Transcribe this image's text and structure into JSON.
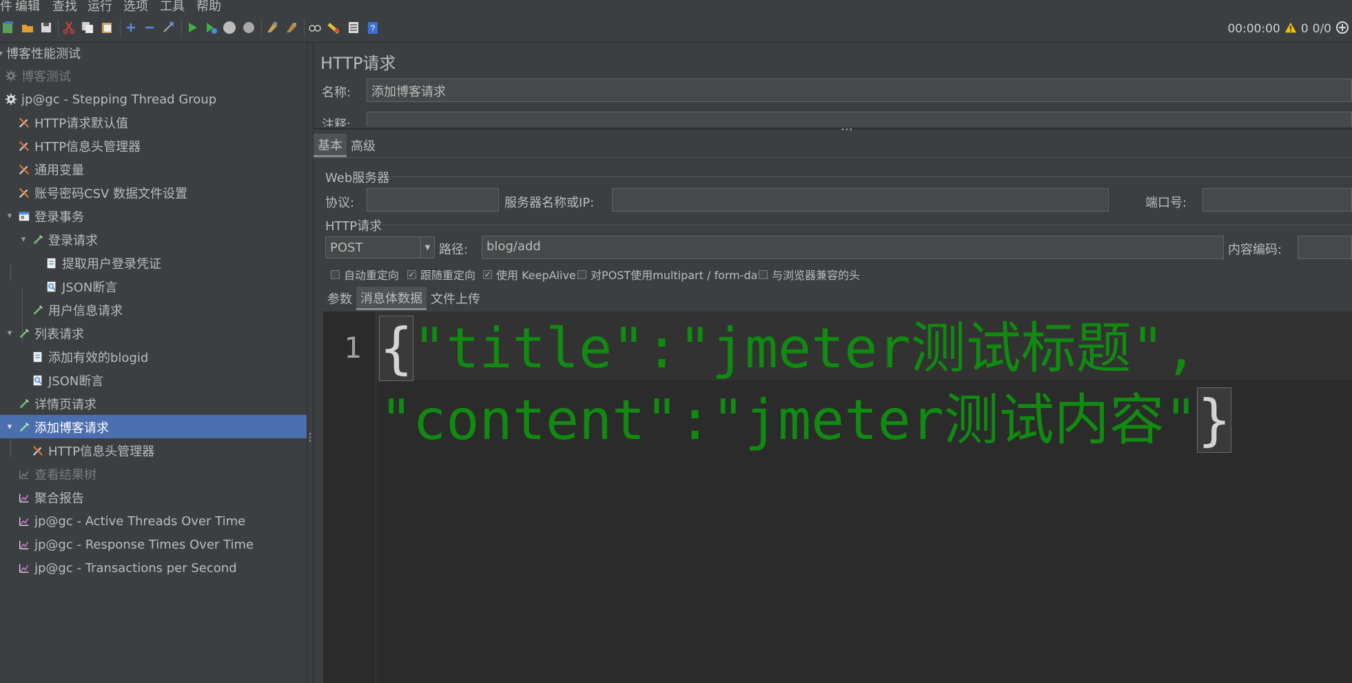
{
  "menu": [
    "件",
    "编辑",
    "查找",
    "运行",
    "选项",
    "工具",
    "帮助"
  ],
  "status": {
    "timer": "00:00:00",
    "warnings": "0",
    "threads": "0/0"
  },
  "tree": {
    "items": [
      {
        "label": "博客性能测试"
      },
      {
        "label": "博客测试"
      },
      {
        "label": "jp@gc - Stepping Thread Group"
      },
      {
        "label": "HTTP请求默认值"
      },
      {
        "label": "HTTP信息头管理器"
      },
      {
        "label": "通用变量"
      },
      {
        "label": "账号密码CSV 数据文件设置"
      },
      {
        "label": "登录事务"
      },
      {
        "label": "登录请求"
      },
      {
        "label": "提取用户登录凭证"
      },
      {
        "label": "JSON断言"
      },
      {
        "label": "用户信息请求"
      },
      {
        "label": "列表请求"
      },
      {
        "label": "添加有效的blogid"
      },
      {
        "label": "JSON断言"
      },
      {
        "label": "详情页请求"
      },
      {
        "label": "添加博客请求"
      },
      {
        "label": "HTTP信息头管理器"
      },
      {
        "label": "查看结果树"
      },
      {
        "label": "聚合报告"
      },
      {
        "label": "jp@gc - Active Threads Over Time"
      },
      {
        "label": "jp@gc - Response Times Over Time"
      },
      {
        "label": "jp@gc - Transactions per Second"
      }
    ]
  },
  "panel": {
    "title": "HTTP请求",
    "name_label": "名称:",
    "name_value": "添加博客请求",
    "comment_label": "注释:",
    "tabs": [
      "基本",
      "高级"
    ],
    "web_server": {
      "title": "Web服务器",
      "protocol_label": "协议:",
      "protocol_value": "",
      "server_label": "服务器名称或IP:",
      "server_value": "",
      "port_label": "端口号:",
      "port_value": ""
    },
    "http_request": {
      "title": "HTTP请求",
      "method": "POST",
      "path_label": "路径:",
      "path_value": "blog/add",
      "encoding_label": "内容编码:",
      "encoding_value": ""
    },
    "options": [
      {
        "label": "自动重定向",
        "checked": false
      },
      {
        "label": "跟随重定向",
        "checked": true
      },
      {
        "label": "使用 KeepAlive",
        "checked": true
      },
      {
        "label": "对POST使用multipart / form-data",
        "checked": false
      },
      {
        "label": "与浏览器兼容的头",
        "checked": false
      }
    ],
    "body_tabs": [
      "参数",
      "消息体数据",
      "文件上传"
    ],
    "editor": {
      "line_number": "1",
      "open_brace": "{",
      "line1": "\"title\":\"jmeter测试标题\",",
      "line2": "\"content\":\"jmeter测试内容\"",
      "close_brace": "}"
    }
  }
}
